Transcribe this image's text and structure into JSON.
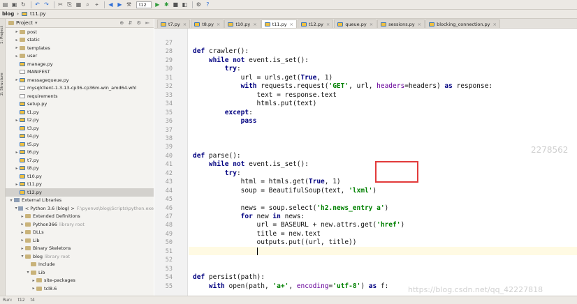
{
  "toolbar": {
    "run_config": "t12",
    "icons": [
      "open-icon",
      "save-icon",
      "sync-icon",
      "undo-icon",
      "redo-icon",
      "cut-icon",
      "copy-icon",
      "paste-icon",
      "find-icon",
      "replace-icon",
      "back-icon",
      "forward-icon",
      "run-icon",
      "debug-icon",
      "stop-icon",
      "settings-icon",
      "help-icon"
    ]
  },
  "breadcrumb": {
    "project": "blog",
    "file": "t11.py"
  },
  "sidebar": {
    "header": "Project",
    "side_tabs": [
      "1: Project",
      "2: Structure"
    ],
    "rows": [
      {
        "indent": 1,
        "arrow": "▸",
        "type": "folder",
        "label": "post"
      },
      {
        "indent": 1,
        "arrow": "▸",
        "type": "folder",
        "label": "static"
      },
      {
        "indent": 1,
        "arrow": "▸",
        "type": "folder",
        "label": "templates"
      },
      {
        "indent": 1,
        "arrow": "▸",
        "type": "folder",
        "label": "user"
      },
      {
        "indent": 1,
        "arrow": "",
        "type": "py",
        "label": "manage.py"
      },
      {
        "indent": 1,
        "arrow": "",
        "type": "file",
        "label": "MANIFEST"
      },
      {
        "indent": 1,
        "arrow": "▸",
        "type": "py",
        "label": "messagequeue.py"
      },
      {
        "indent": 1,
        "arrow": "",
        "type": "file",
        "label": "mysqlclient-1.3.13-cp36-cp36m-win_amd64.whl"
      },
      {
        "indent": 1,
        "arrow": "",
        "type": "file",
        "label": "requirements"
      },
      {
        "indent": 1,
        "arrow": "",
        "type": "py",
        "label": "setup.py"
      },
      {
        "indent": 1,
        "arrow": "",
        "type": "py",
        "label": "t1.py"
      },
      {
        "indent": 1,
        "arrow": "▸",
        "type": "py",
        "label": "t2.py"
      },
      {
        "indent": 1,
        "arrow": "",
        "type": "py",
        "label": "t3.py"
      },
      {
        "indent": 1,
        "arrow": "",
        "type": "py",
        "label": "t4.py"
      },
      {
        "indent": 1,
        "arrow": "",
        "type": "py",
        "label": "t5.py"
      },
      {
        "indent": 1,
        "arrow": "▸",
        "type": "py",
        "label": "t6.py"
      },
      {
        "indent": 1,
        "arrow": "",
        "type": "py",
        "label": "t7.py"
      },
      {
        "indent": 1,
        "arrow": "▸",
        "type": "py",
        "label": "t8.py"
      },
      {
        "indent": 1,
        "arrow": "",
        "type": "py",
        "label": "t10.py"
      },
      {
        "indent": 1,
        "arrow": "▸",
        "type": "py",
        "label": "t11.py"
      },
      {
        "indent": 1,
        "arrow": "",
        "type": "py",
        "label": "t12.py",
        "selected": true
      },
      {
        "indent": 0,
        "arrow": "▾",
        "type": "lib",
        "label": "External Libraries"
      },
      {
        "indent": 1,
        "arrow": "▾",
        "type": "lib",
        "label": "< Python 3.6 (blog) >",
        "muted": "F:\\pyenvs\\blog\\Scripts\\python.exe"
      },
      {
        "indent": 2,
        "arrow": "▸",
        "type": "folder",
        "label": "Extended Definitions"
      },
      {
        "indent": 2,
        "arrow": "▸",
        "type": "folder",
        "label": "Python366",
        "muted": "library root"
      },
      {
        "indent": 2,
        "arrow": "▸",
        "type": "folder",
        "label": "DLLs"
      },
      {
        "indent": 2,
        "arrow": "▸",
        "type": "folder",
        "label": "Lib"
      },
      {
        "indent": 2,
        "arrow": "▸",
        "type": "folder",
        "label": "Binary Skeletons"
      },
      {
        "indent": 2,
        "arrow": "▾",
        "type": "folder",
        "label": "blog",
        "muted": "library root"
      },
      {
        "indent": 3,
        "arrow": "",
        "type": "folder",
        "label": "Include"
      },
      {
        "indent": 3,
        "arrow": "▾",
        "type": "folder",
        "label": "Lib"
      },
      {
        "indent": 4,
        "arrow": "▸",
        "type": "folder",
        "label": "site-packages"
      },
      {
        "indent": 4,
        "arrow": "▸",
        "type": "folder",
        "label": "tcl8.6"
      }
    ]
  },
  "tabs": [
    {
      "label": "t7.py",
      "active": false
    },
    {
      "label": "t8.py",
      "active": false
    },
    {
      "label": "t10.py",
      "active": false
    },
    {
      "label": "t11.py",
      "active": true
    },
    {
      "label": "t12.py",
      "active": false
    },
    {
      "label": "queue.py",
      "active": false
    },
    {
      "label": "sessions.py",
      "active": false
    },
    {
      "label": "blocking_connection.py",
      "active": false
    }
  ],
  "editor": {
    "current_line": 51,
    "lines": [
      {
        "n": "27",
        "html": ""
      },
      {
        "n": "28",
        "html": "<span class='kw'>def</span> crawler():"
      },
      {
        "n": "29",
        "html": "    <span class='kw'>while not</span> event.is_set():"
      },
      {
        "n": "30",
        "html": "        <span class='kw'>try</span>:"
      },
      {
        "n": "31",
        "html": "            url = urls.get(<span class='kw'>True</span>, 1)"
      },
      {
        "n": "32",
        "html": "            <span class='kw'>with</span> requests.request(<span class='str'>'GET'</span>, url, <span class='kwarg'>headers</span>=headers) <span class='kw'>as</span> response:"
      },
      {
        "n": "33",
        "html": "                text = response.text"
      },
      {
        "n": "34",
        "html": "                htmls.put(text)"
      },
      {
        "n": "35",
        "html": "        <span class='kw'>except</span>:"
      },
      {
        "n": "36",
        "html": "            <span class='kw'>pass</span>"
      },
      {
        "n": "37",
        "html": ""
      },
      {
        "n": "38",
        "html": ""
      },
      {
        "n": "39",
        "html": ""
      },
      {
        "n": "40",
        "html": "<span class='kw'>def</span> parse():"
      },
      {
        "n": "41",
        "html": "    <span class='kw'>while not</span> event.is_set():"
      },
      {
        "n": "42",
        "html": "        <span class='kw'>try</span>:"
      },
      {
        "n": "43",
        "html": "            html = htmls.get(<span class='kw'>True</span>, 1)"
      },
      {
        "n": "44",
        "html": "            soup = BeautifulSoup(text, <span class='str'>'lxml'</span>)"
      },
      {
        "n": "45",
        "html": ""
      },
      {
        "n": "46",
        "html": "            news = soup.select(<span class='str'>'h2.news_entry a'</span>)"
      },
      {
        "n": "47",
        "html": "            <span class='kw'>for</span> new <span class='kw'>in</span> news:"
      },
      {
        "n": "48",
        "html": "                url = BASEURL + new.attrs.get(<span class='str'>'href'</span>)"
      },
      {
        "n": "49",
        "html": "                title = new.text"
      },
      {
        "n": "50",
        "html": "                outputs.put((url, title))"
      },
      {
        "n": "51",
        "html": ""
      },
      {
        "n": "52",
        "html": ""
      },
      {
        "n": "53",
        "html": ""
      },
      {
        "n": "54",
        "html": "<span class='kw'>def</span> persist(path):"
      },
      {
        "n": "55",
        "html": "    <span class='kw'>with</span> open(path, <span class='str'>'a+'</span>, <span class='kwarg'>encoding</span>=<span class='str'>'utf-8'</span>) <span class='kw'>as</span> f:"
      }
    ]
  },
  "watermark": {
    "number": "2278562",
    "url": "https://blog.csdn.net/qq_42227818"
  },
  "statusbar": {
    "left": "Run:",
    "tab1": "t12",
    "tab2": "t4"
  }
}
